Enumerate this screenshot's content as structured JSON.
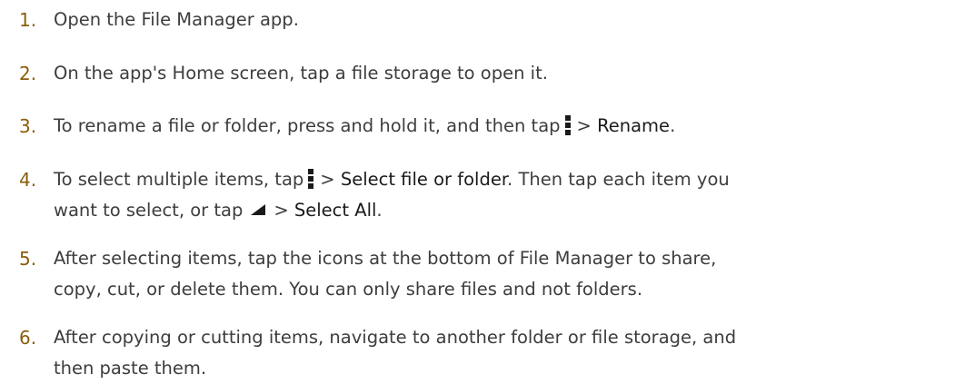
{
  "steps": [
    {
      "number": "1.",
      "text": "Open the File Manager app."
    },
    {
      "number": "2.",
      "text": "On the app's Home screen, tap a file storage to open it."
    },
    {
      "number": "3.",
      "text_before": "To rename a file or folder, press and hold it, and then tap",
      "icon": "menu-icon",
      "sep": "> ",
      "action": "Rename",
      "end": "."
    },
    {
      "number": "4.",
      "line1_before": "To select multiple items, tap",
      "icon1": "menu-icon",
      "sep1": "> ",
      "action1": "Select file or folder",
      "line1_after": ". Then tap each item you",
      "line2_before": "want to select, or tap",
      "icon2": "triangle-icon",
      "sep2": "> ",
      "action2": "Select All",
      "end": "."
    },
    {
      "number": "5.",
      "line1": "After selecting items, tap the icons at the bottom of File Manager to share,",
      "line2": "copy, cut, or delete them. You can only share files and not folders."
    },
    {
      "number": "6.",
      "line1": "After copying or cutting items, navigate to another folder or file storage, and",
      "line2": "then paste them."
    }
  ]
}
